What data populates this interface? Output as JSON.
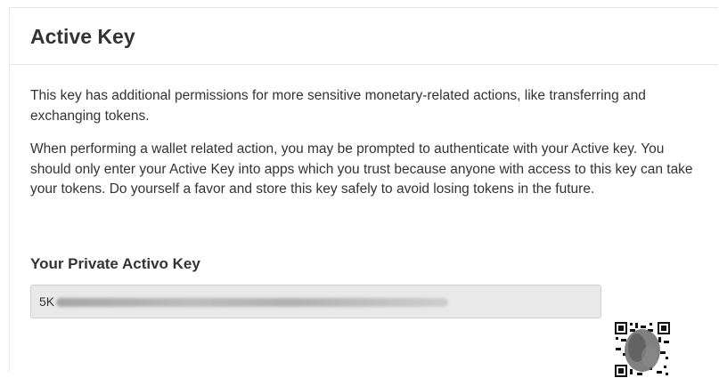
{
  "header": {
    "title": "Active Key"
  },
  "description": {
    "paragraph_1": "This key has additional permissions for more sensitive monetary-related actions, like transferring and exchanging tokens.",
    "paragraph_2": "When performing a wallet related action, you may be prompted to authenticate with your Active key. You should only enter your Active Key into apps which you trust because anyone with access to this key can take your tokens. Do yourself a favor and store this key safely to avoid losing tokens in the future."
  },
  "private_key": {
    "label": "Your Private Activo Key",
    "value": "5K"
  },
  "colors": {
    "text": "#333333",
    "input_background": "#e9e9e9",
    "border": "#e6e6e6"
  },
  "icons": {
    "qr": "qr-code-icon"
  }
}
